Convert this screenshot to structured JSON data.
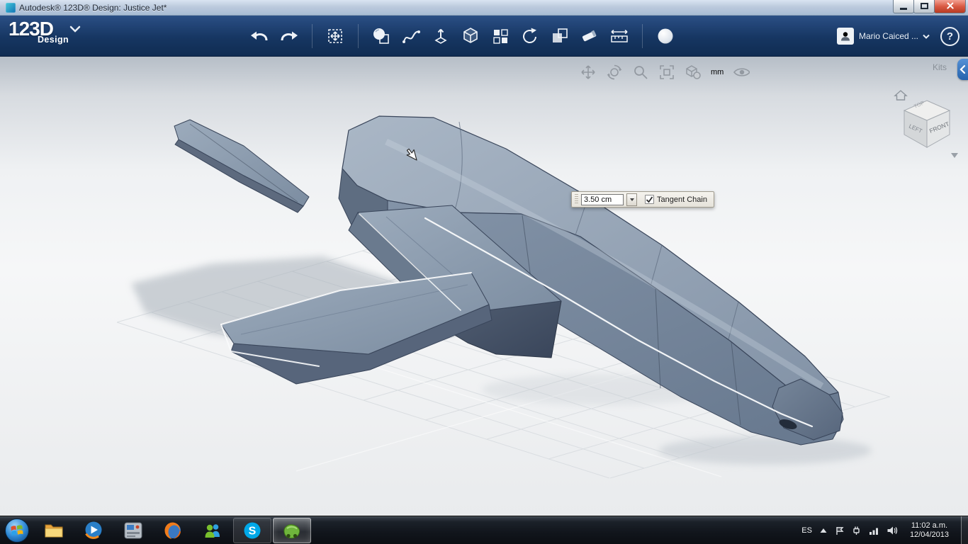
{
  "window": {
    "title": "Autodesk® 123D® Design: Justice Jet*"
  },
  "appbar": {
    "brand": "123D",
    "brand_sub": "Design",
    "user_name": "Mario Caiced ...",
    "help_glyph": "?",
    "tool_icons": [
      {
        "name": "undo"
      },
      {
        "name": "redo"
      },
      {
        "name": "move-transform"
      },
      {
        "name": "primitives"
      },
      {
        "name": "sketch"
      },
      {
        "name": "extrude"
      },
      {
        "name": "construct"
      },
      {
        "name": "pattern"
      },
      {
        "name": "revolve"
      },
      {
        "name": "combine"
      },
      {
        "name": "snap"
      },
      {
        "name": "measure"
      },
      {
        "name": "material"
      }
    ]
  },
  "viewport": {
    "kits_label": "Kits",
    "units_label": "mm",
    "nav_icons": [
      {
        "name": "pan"
      },
      {
        "name": "orbit"
      },
      {
        "name": "zoom"
      },
      {
        "name": "fit"
      },
      {
        "name": "display-style"
      },
      {
        "name": "units"
      },
      {
        "name": "visibility"
      }
    ],
    "viewcube": {
      "front": "FRONT",
      "left": "LEFT",
      "top": "TOP"
    },
    "dim_popup": {
      "value": "3.50 cm",
      "checkbox_checked": true,
      "checkbox_label": "Tangent Chain"
    }
  },
  "taskbar": {
    "apps": [
      {
        "name": "windows-explorer"
      },
      {
        "name": "media-player"
      },
      {
        "name": "design-tool"
      },
      {
        "name": "firefox"
      },
      {
        "name": "messenger"
      },
      {
        "name": "skype",
        "glyph": "S",
        "state": "open"
      },
      {
        "name": "123d-design",
        "state": "active"
      }
    ],
    "tray": {
      "language": "ES",
      "time": "11:02 a.m.",
      "date": "12/04/2013"
    }
  },
  "colors": {
    "header_blue": "#163662",
    "tab_blue": "#2e6cb4",
    "close_red": "#c9422f",
    "model_gray": "#8b9aad",
    "active_green": "#6fb53c",
    "highlight_edge": "#ffffff"
  }
}
